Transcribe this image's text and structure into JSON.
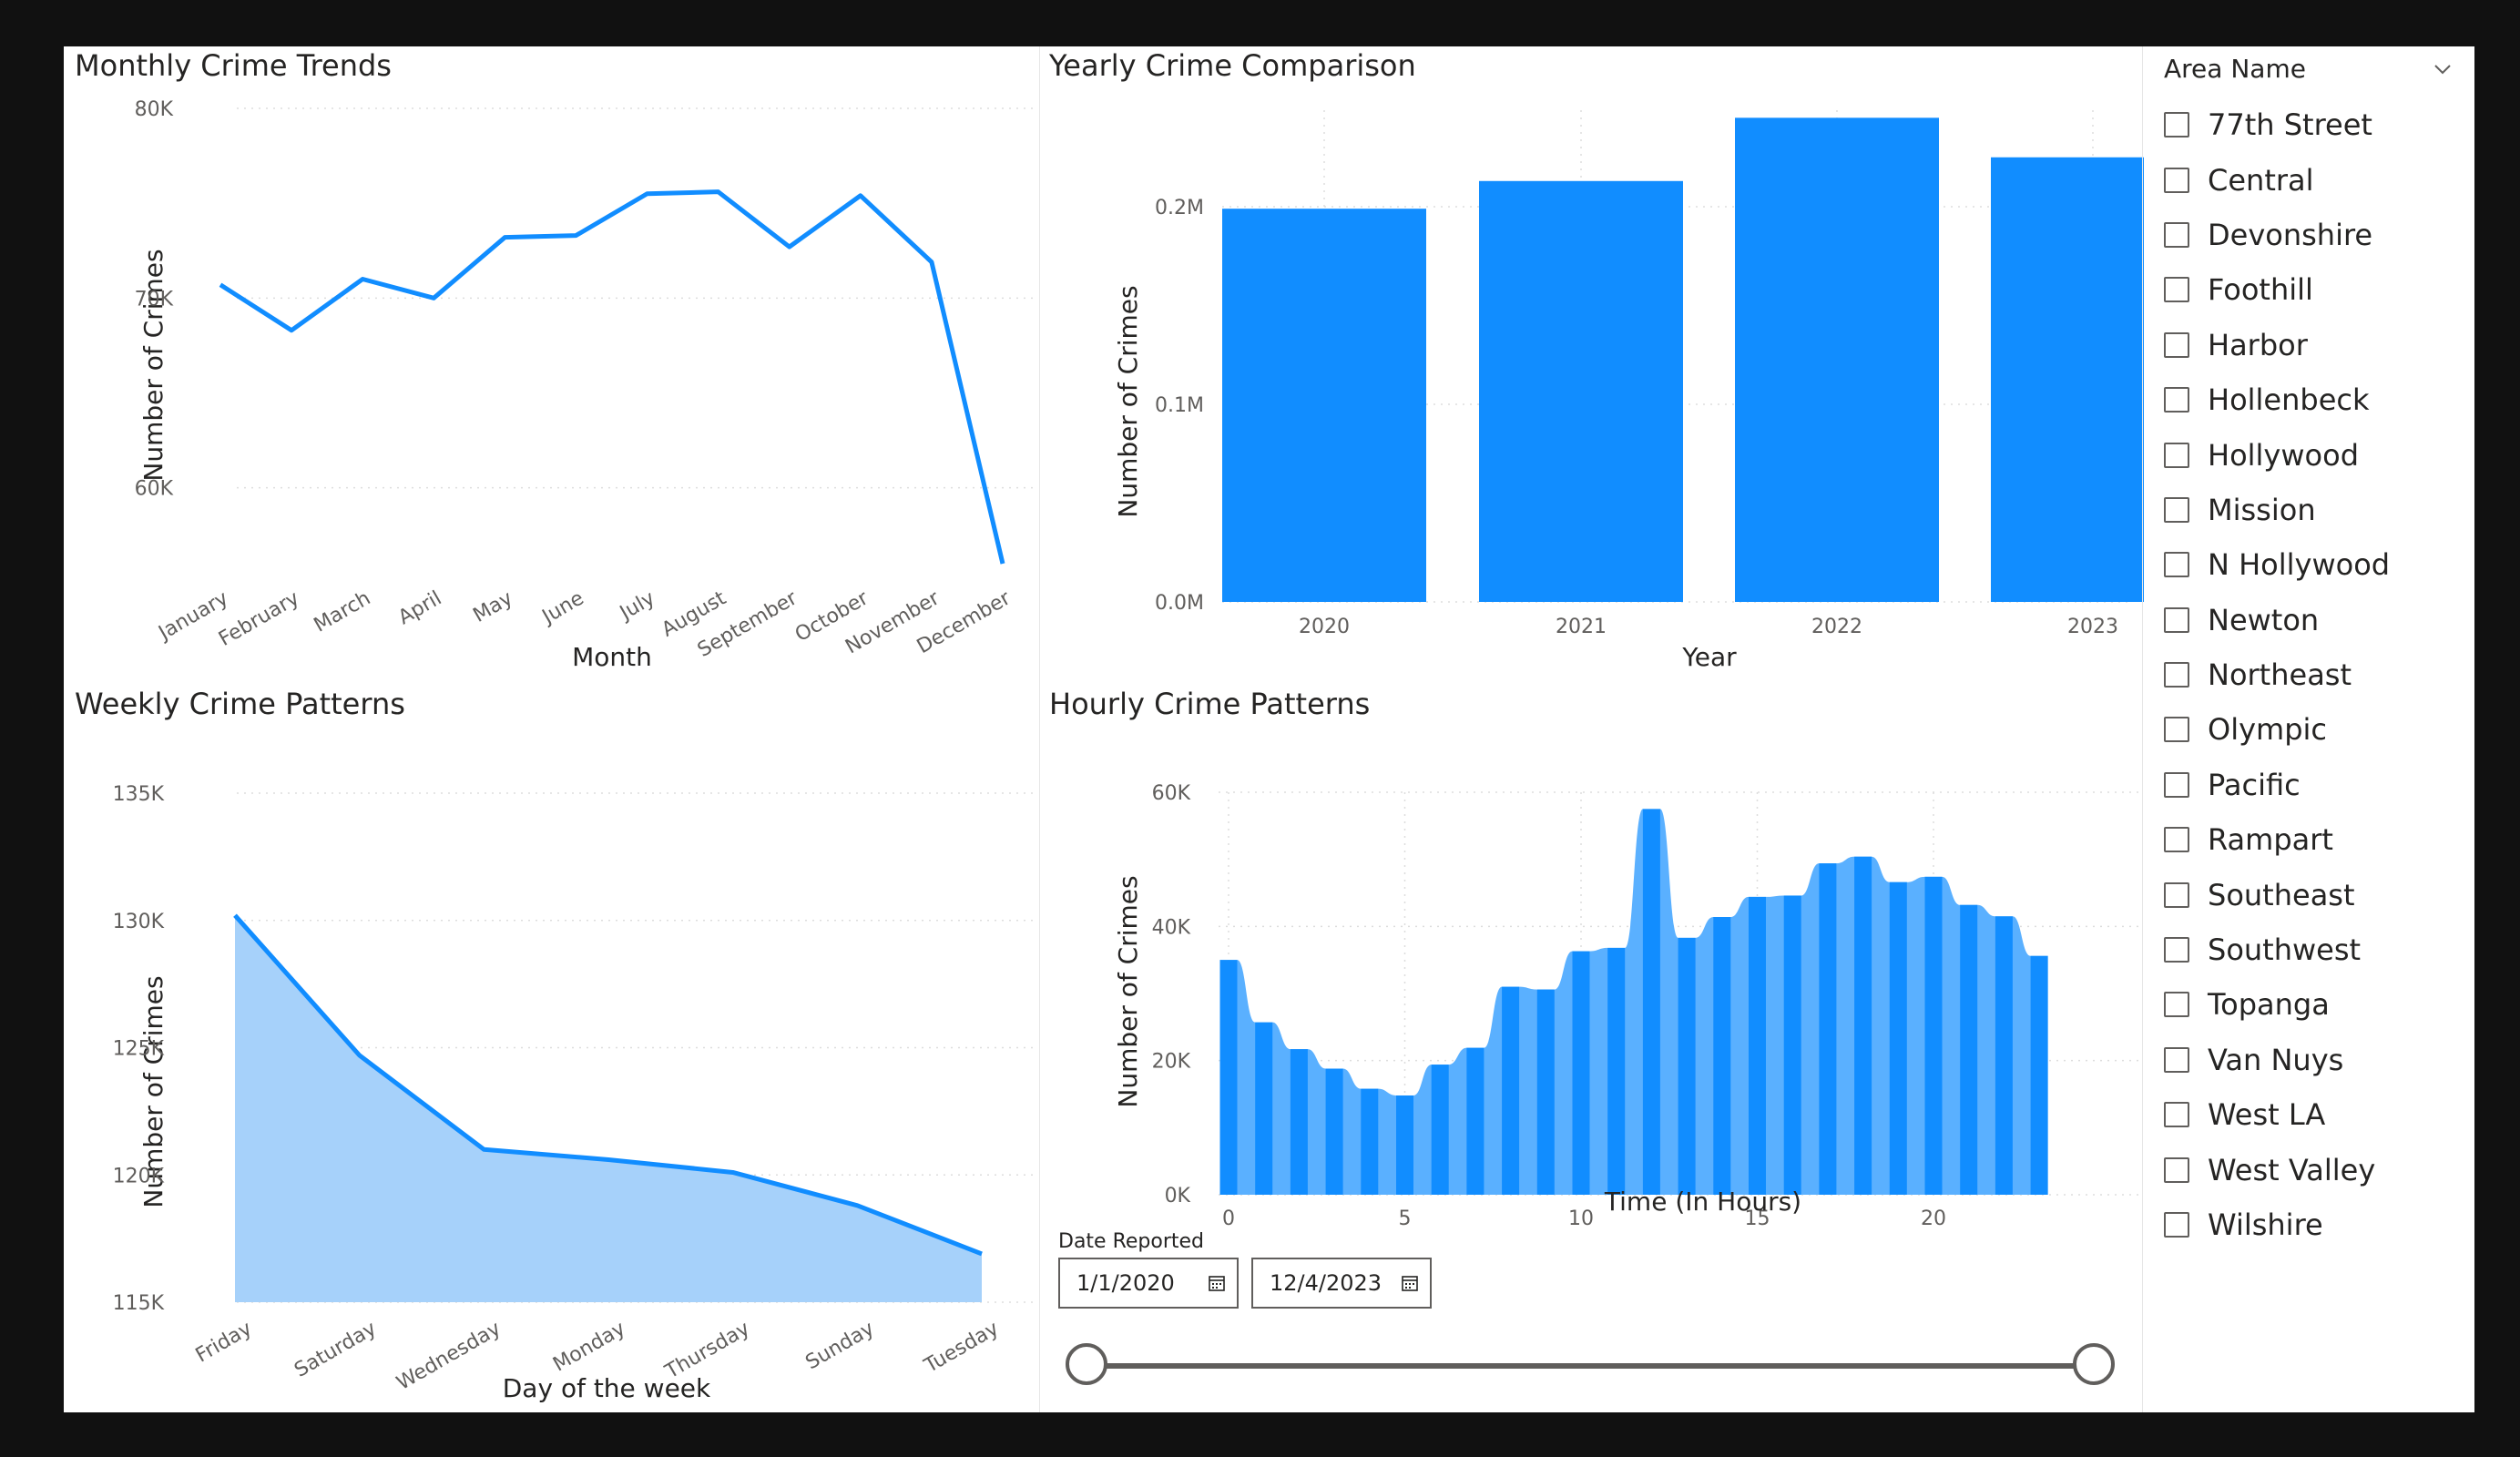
{
  "colors": {
    "accent": "#118dff",
    "accent_light": "#5ab0ff",
    "area_fill": "#a6d1fa",
    "text": "#252423",
    "tick": "#605e5c",
    "grid": "#dddddd"
  },
  "charts": {
    "monthly": {
      "title": "Monthly Crime Trends",
      "xlabel": "Month",
      "ylabel": "Number of Crimes",
      "yticks": [
        "60K",
        "70K",
        "80K"
      ]
    },
    "yearly": {
      "title": "Yearly Crime Comparison",
      "xlabel": "Year",
      "ylabel": "Number of Crimes",
      "yticks": [
        "0.0M",
        "0.1M",
        "0.2M"
      ]
    },
    "weekly": {
      "title": "Weekly Crime Patterns",
      "xlabel": "Day of the week",
      "ylabel": "Number of Crimes",
      "yticks": [
        "115K",
        "120K",
        "125K",
        "130K",
        "135K"
      ]
    },
    "hourly": {
      "title": "Hourly Crime Patterns",
      "xlabel": "Time (In Hours)",
      "ylabel": "Number of Crimes",
      "yticks": [
        "0K",
        "20K",
        "40K",
        "60K"
      ],
      "xticks": [
        "0",
        "5",
        "10",
        "15",
        "20"
      ]
    }
  },
  "chart_data": [
    {
      "type": "line",
      "title": "Monthly Crime Trends",
      "xlabel": "Month",
      "ylabel": "Number of Crimes",
      "categories": [
        "January",
        "February",
        "March",
        "April",
        "May",
        "June",
        "July",
        "August",
        "September",
        "October",
        "November",
        "December"
      ],
      "values": [
        70700,
        68300,
        71000,
        70000,
        73200,
        73300,
        75500,
        75600,
        72700,
        75400,
        71900,
        56000
      ],
      "ylim": [
        56000,
        80000
      ],
      "grid": true
    },
    {
      "type": "bar",
      "title": "Yearly Crime Comparison",
      "xlabel": "Year",
      "ylabel": "Number of Crimes",
      "categories": [
        "2020",
        "2021",
        "2022",
        "2023"
      ],
      "values": [
        199000,
        213000,
        245000,
        225000
      ],
      "ylim": [
        0,
        250000
      ],
      "grid": true
    },
    {
      "type": "area",
      "title": "Weekly Crime Patterns",
      "xlabel": "Day of the week",
      "ylabel": "Number of Crimes",
      "categories": [
        "Friday",
        "Saturday",
        "Wednesday",
        "Monday",
        "Thursday",
        "Sunday",
        "Tuesday"
      ],
      "values": [
        130200,
        124700,
        121000,
        120600,
        120100,
        118800,
        116900
      ],
      "ylim": [
        115000,
        135000
      ],
      "grid": true
    },
    {
      "type": "bar",
      "title": "Hourly Crime Patterns",
      "xlabel": "Time (In Hours)",
      "ylabel": "Number of Crimes",
      "x": [
        0,
        1,
        2,
        3,
        4,
        5,
        6,
        7,
        8,
        9,
        10,
        11,
        12,
        13,
        14,
        15,
        16,
        17,
        18,
        19,
        20,
        21,
        22,
        23
      ],
      "values": [
        35000,
        25700,
        21700,
        18800,
        15800,
        14800,
        19400,
        21900,
        31000,
        30600,
        36300,
        36800,
        57500,
        38300,
        41400,
        44400,
        44600,
        49400,
        50400,
        46600,
        47400,
        43200,
        41500,
        35600
      ],
      "ylim": [
        0,
        60000
      ],
      "grid": true
    }
  ],
  "slicer": {
    "title": "Area Name",
    "items": [
      "77th Street",
      "Central",
      "Devonshire",
      "Foothill",
      "Harbor",
      "Hollenbeck",
      "Hollywood",
      "Mission",
      "N Hollywood",
      "Newton",
      "Northeast",
      "Olympic",
      "Pacific",
      "Rampart",
      "Southeast",
      "Southwest",
      "Topanga",
      "Van Nuys",
      "West LA",
      "West Valley",
      "Wilshire"
    ]
  },
  "date_slicer": {
    "label": "Date Reported",
    "start": "1/1/2020",
    "end": "12/4/2023"
  }
}
